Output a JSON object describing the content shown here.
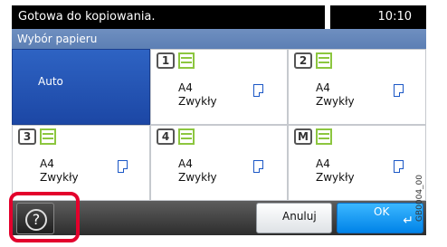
{
  "status": {
    "message": "Gotowa do kopiowania.",
    "time": "10:10"
  },
  "subtitle": "Wybór papieru",
  "cells": [
    {
      "id": "auto",
      "label": "Auto"
    },
    {
      "id": "cassette1",
      "badge": "1",
      "size": "A4",
      "type": "Zwykły"
    },
    {
      "id": "cassette2",
      "badge": "2",
      "size": "A4",
      "type": "Zwykły"
    },
    {
      "id": "cassette3",
      "badge": "3",
      "size": "A4",
      "type": "Zwykły"
    },
    {
      "id": "cassette4",
      "badge": "4",
      "size": "A4",
      "type": "Zwykły"
    },
    {
      "id": "mp",
      "badge": "M",
      "size": "A4",
      "type": "Zwykły"
    }
  ],
  "buttons": {
    "help": "?",
    "cancel": "Anuluj",
    "ok": "OK",
    "enter": "↵"
  },
  "side_code": "GB0004_00",
  "colors": {
    "accent": "#0083e8",
    "highlight": "#e3002c",
    "tray_green": "#8cc63f"
  }
}
